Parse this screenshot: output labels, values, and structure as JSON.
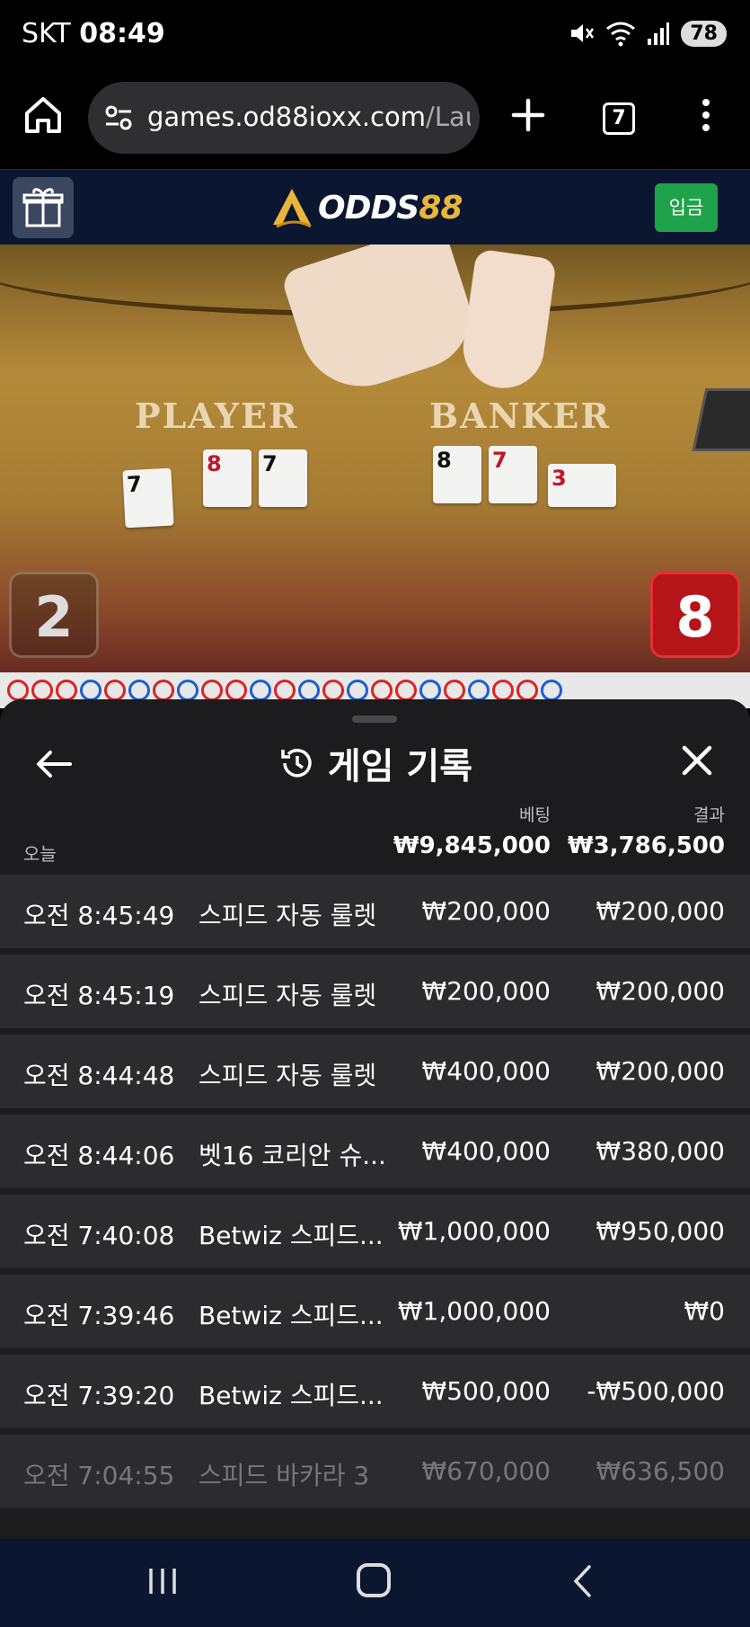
{
  "status_bar": {
    "carrier": "SKT",
    "time": "08:49",
    "battery": "78"
  },
  "browser": {
    "url_main": "games.od88ioxx.com",
    "url_path": "/Laun",
    "tab_count": "7"
  },
  "site_header": {
    "logo_prefix": "ODDS",
    "logo_suffix": "88",
    "deposit_label": "입금"
  },
  "video": {
    "player_label": "PLAYER",
    "banker_label": "BANKER",
    "player_cards": [
      "7",
      "8",
      "7"
    ],
    "banker_cards": [
      "8",
      "7",
      "3"
    ],
    "player_score": "2",
    "banker_score": "8"
  },
  "panel": {
    "title": "게임 기록",
    "col_bet": "베팅",
    "col_result": "결과",
    "today_label": "오늘",
    "total_bet": "₩9,845,000",
    "total_result": "₩3,786,500",
    "rows": [
      {
        "time": "오전 8:45:49",
        "game": "스피드 자동 룰렛",
        "bet": "₩200,000",
        "result": "₩200,000"
      },
      {
        "time": "오전 8:45:19",
        "game": "스피드 자동 룰렛",
        "bet": "₩200,000",
        "result": "₩200,000"
      },
      {
        "time": "오전 8:44:48",
        "game": "스피드 자동 룰렛",
        "bet": "₩400,000",
        "result": "₩200,000"
      },
      {
        "time": "오전 8:44:06",
        "game": "벳16 코리안 슈...",
        "bet": "₩400,000",
        "result": "₩380,000"
      },
      {
        "time": "오전 7:40:08",
        "game": "Betwiz 스피드...",
        "bet": "₩1,000,000",
        "result": "₩950,000"
      },
      {
        "time": "오전 7:39:46",
        "game": "Betwiz 스피드...",
        "bet": "₩1,000,000",
        "result": "₩0"
      },
      {
        "time": "오전 7:39:20",
        "game": "Betwiz 스피드...",
        "bet": "₩500,000",
        "result": "-₩500,000"
      },
      {
        "time": "오전 7:04:55",
        "game": "스피드 바카라 3",
        "bet": "₩670,000",
        "result": "₩636,500"
      }
    ]
  },
  "colors": {
    "header_bg": "#0b1730",
    "deposit_green": "#1ea34a",
    "logo_gold": "#e9b53a",
    "panel_bg": "#1c1c1e",
    "row_bg": "#2c2c2e"
  }
}
